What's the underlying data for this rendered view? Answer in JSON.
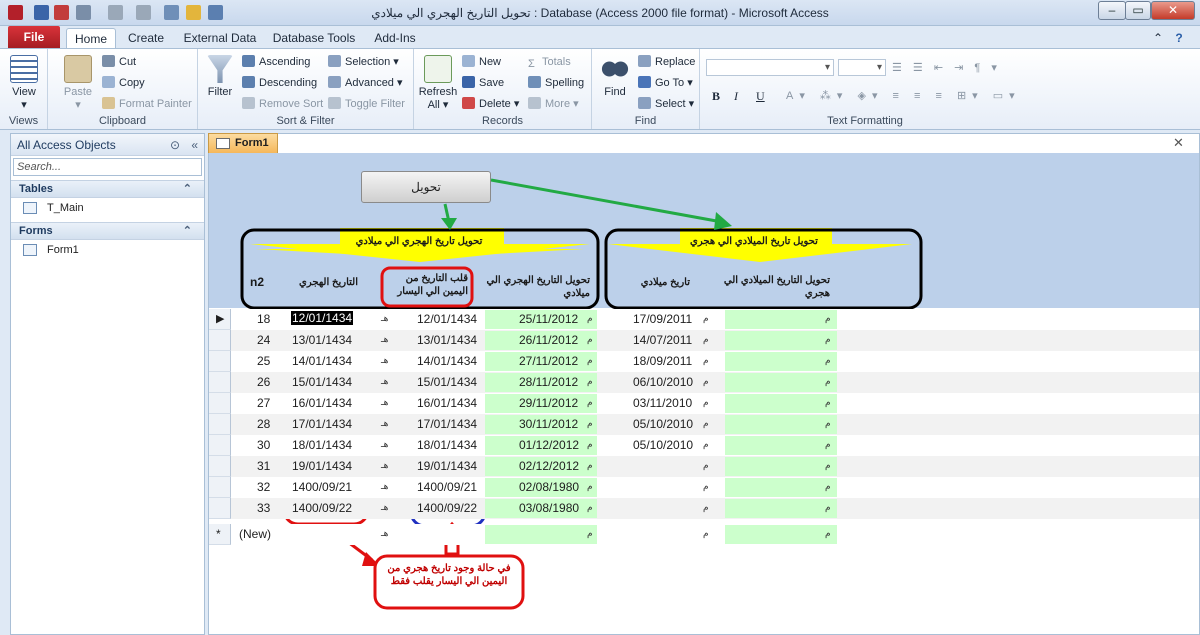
{
  "window": {
    "title": "تحويل التاريخ الهجري الي ميلادي : Database (Access 2000 file format) - Microsoft Access",
    "min": "–",
    "max": "▭",
    "close": "✕"
  },
  "ribbon_tabs": [
    "File",
    "Home",
    "Create",
    "External Data",
    "Database Tools",
    "Add-Ins"
  ],
  "ribbon": {
    "views": {
      "view": "View",
      "group": "Views"
    },
    "clipboard": {
      "paste": "Paste",
      "cut": "Cut",
      "copy": "Copy",
      "format_painter": "Format Painter",
      "group": "Clipboard"
    },
    "sort_filter": {
      "filter": "Filter",
      "ascending": "Ascending",
      "descending": "Descending",
      "remove_sort": "Remove Sort",
      "selection": "Selection ▾",
      "advanced": "Advanced ▾",
      "toggle_filter": "Toggle Filter",
      "group": "Sort & Filter"
    },
    "records": {
      "refresh": "Refresh",
      "all": "All ▾",
      "new": "New",
      "save": "Save",
      "delete": "Delete ▾",
      "totals": "Totals",
      "spelling": "Spelling",
      "more": "More ▾",
      "group": "Records"
    },
    "find": {
      "find": "Find",
      "replace": "Replace",
      "goto": "Go To ▾",
      "select": "Select ▾",
      "group": "Find"
    },
    "text_formatting": {
      "group": "Text Formatting",
      "bold": "B",
      "italic": "I",
      "underline": "U"
    }
  },
  "nav": {
    "header": "All Access Objects",
    "search_placeholder": "Search...",
    "sections": [
      {
        "name": "Tables",
        "items": [
          "T_Main"
        ]
      },
      {
        "name": "Forms",
        "items": [
          "Form1"
        ]
      }
    ]
  },
  "doc_tab": "Form1",
  "form": {
    "button_label": "تحويل",
    "left_box_title": "تحويل تاريخ الهجري الي ميلادي",
    "right_box_title": "تحويل تاريخ الميلادي الي هجري",
    "col_n2": "n2",
    "col_hijri": "التاريخ الهجري",
    "col_flip": "قلب التاريخ من اليمين الي اليسار",
    "col_conv_hg": "تحويل التاريخ الهجري الي ميلادي",
    "col_greg": "تاريخ ميلادي",
    "col_conv_gh": "تحويل التاريخ الميلادي الي هجري",
    "hijri_suffix": "هـ",
    "greg_suffix": "م",
    "new_label": "(New)",
    "annotation": "في حالة وجود تاريخ هجري من اليمين الي اليسار يقلب فقط"
  },
  "rows": [
    {
      "n2": "18",
      "hijri": "12/01/1434",
      "flip": "12/01/1434",
      "conv": "25/11/2012",
      "greg": "17/09/2011"
    },
    {
      "n2": "24",
      "hijri": "13/01/1434",
      "flip": "13/01/1434",
      "conv": "26/11/2012",
      "greg": "14/07/2011"
    },
    {
      "n2": "25",
      "hijri": "14/01/1434",
      "flip": "14/01/1434",
      "conv": "27/11/2012",
      "greg": "18/09/2011"
    },
    {
      "n2": "26",
      "hijri": "15/01/1434",
      "flip": "15/01/1434",
      "conv": "28/11/2012",
      "greg": "06/10/2010"
    },
    {
      "n2": "27",
      "hijri": "16/01/1434",
      "flip": "16/01/1434",
      "conv": "29/11/2012",
      "greg": "03/11/2010"
    },
    {
      "n2": "28",
      "hijri": "17/01/1434",
      "flip": "17/01/1434",
      "conv": "30/11/2012",
      "greg": "05/10/2010"
    },
    {
      "n2": "30",
      "hijri": "18/01/1434",
      "flip": "18/01/1434",
      "conv": "01/12/2012",
      "greg": "05/10/2010"
    },
    {
      "n2": "31",
      "hijri": "19/01/1434",
      "flip": "19/01/1434",
      "conv": "02/12/2012",
      "greg": ""
    },
    {
      "n2": "32",
      "hijri": "1400/09/21",
      "flip": "1400/09/21",
      "conv": "02/08/1980",
      "greg": ""
    },
    {
      "n2": "33",
      "hijri": "1400/09/22",
      "flip": "1400/09/22",
      "conv": "03/08/1980",
      "greg": ""
    }
  ]
}
